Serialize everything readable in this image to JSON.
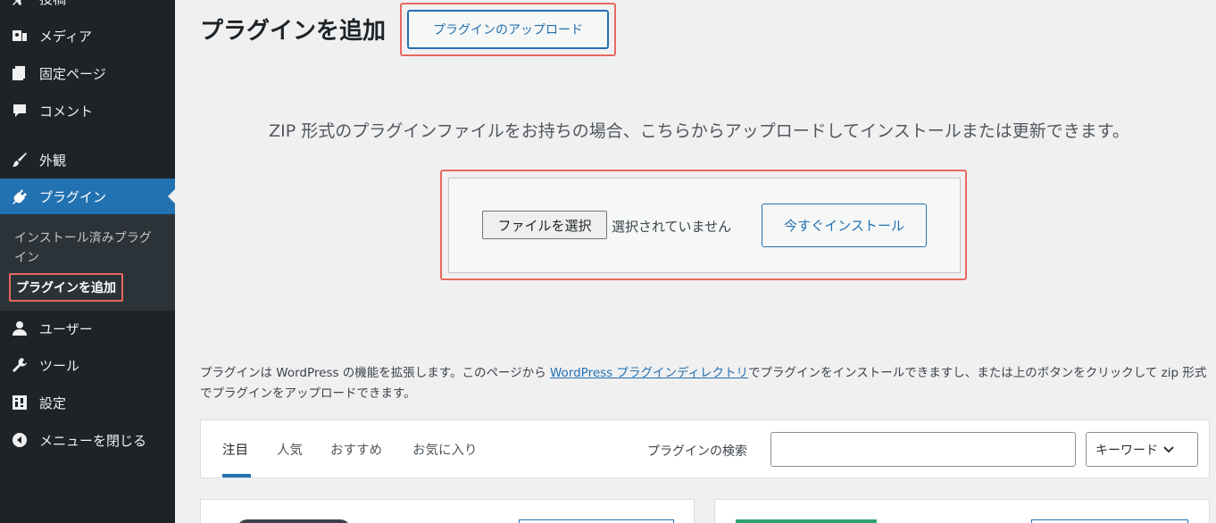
{
  "sidebar": {
    "items": [
      {
        "label": "投稿",
        "icon": "pin-icon"
      },
      {
        "label": "メディア",
        "icon": "media-icon"
      },
      {
        "label": "固定ページ",
        "icon": "page-icon"
      },
      {
        "label": "コメント",
        "icon": "comment-icon"
      },
      {
        "label": "外観",
        "icon": "appearance-brush-icon"
      },
      {
        "label": "プラグイン",
        "icon": "plugin-icon"
      },
      {
        "label": "ユーザー",
        "icon": "user-icon"
      },
      {
        "label": "ツール",
        "icon": "wrench-icon"
      },
      {
        "label": "設定",
        "icon": "settings-icon"
      },
      {
        "label": "メニューを閉じる",
        "icon": "collapse-icon"
      }
    ],
    "submenu": {
      "installed": "インストール済みプラグイン",
      "add_new": "プラグインを追加"
    }
  },
  "main": {
    "title": "プラグインを追加",
    "upload_button": "プラグインのアップロード",
    "zip_description": "ZIP 形式のプラグインファイルをお持ちの場合、こちらからアップロードしてインストールまたは更新できます。",
    "file_button": "ファイルを選択",
    "file_status": "選択されていません",
    "install_button": "今すぐインストール",
    "intro": {
      "before": "プラグインは WordPress の機能を拡張します。このページから ",
      "link": "WordPress プラグインディレクトリ",
      "after": "でプラグインをインストールできますし、または上のボタンをクリックして zip 形式でプラグインをアップロードできます。"
    },
    "tabs": [
      "注目",
      "人気",
      "おすすめ",
      "お気に入り"
    ],
    "search_label": "プラグインの検索",
    "search_value": "",
    "search_type": "キーワード"
  },
  "colors": {
    "sidebar_bg": "#1d2327",
    "accent": "#2271b1",
    "highlight": "#e8675f"
  }
}
